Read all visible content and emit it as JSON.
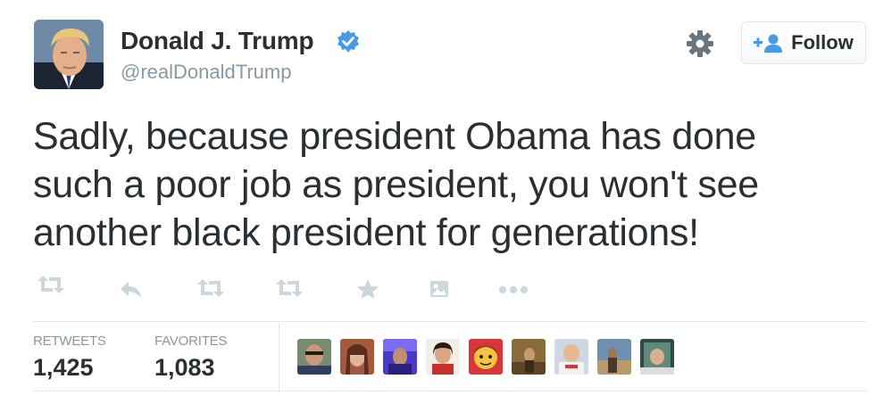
{
  "user": {
    "name": "Donald J. Trump",
    "handle": "@realDonaldTrump",
    "avatar_icon": "avatar-photo",
    "verified_icon": "verified-badge-icon",
    "verified_color": "#4a99e9"
  },
  "header": {
    "settings_icon": "gear-icon",
    "follow_label": "Follow",
    "follow_icon": "add-user-icon",
    "follow_icon_color": "#4a99e9"
  },
  "tweet": {
    "lines": [
      "Sadly, because president Obama has done",
      "such a poor job as president, you won't see",
      "another black president for generations!"
    ]
  },
  "actions": {
    "icons": [
      "retweet-icon",
      "reply-icon",
      "retweet-icon",
      "retweet-icon",
      "favorite-star-icon",
      "image-icon",
      "more-icon"
    ],
    "icon_color": "#ccd6dd"
  },
  "stats": {
    "retweets_label": "RETWEETS",
    "retweets_value": "1,425",
    "favorites_label": "FAVORITES",
    "favorites_value": "1,083"
  },
  "favorited_by": {
    "count_shown": 9,
    "avatars": [
      "favoriter-avatar-1",
      "favoriter-avatar-2",
      "favoriter-avatar-3",
      "favoriter-avatar-4",
      "favoriter-avatar-5",
      "favoriter-avatar-6",
      "favoriter-avatar-7",
      "favoriter-avatar-8",
      "favoriter-avatar-9"
    ]
  }
}
